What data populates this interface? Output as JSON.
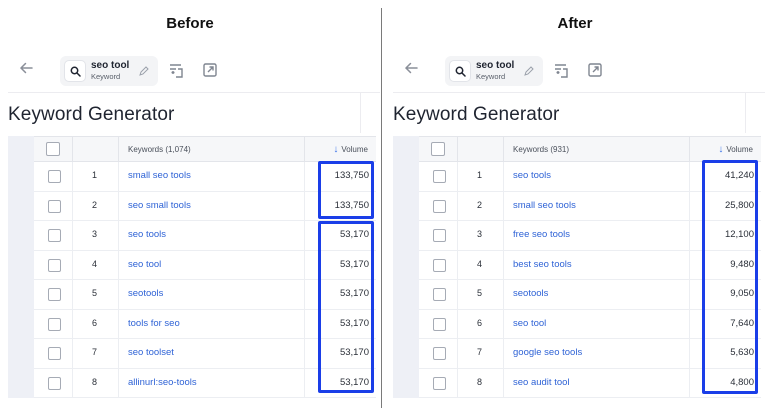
{
  "headings": {
    "before": "Before",
    "after": "After"
  },
  "panels": {
    "before": {
      "chip_title": "seo tool",
      "chip_sub": "Keyword",
      "title": "Keyword Generator",
      "col_keywords": "Keywords (1,074)",
      "col_volume": "Volume",
      "rows": [
        {
          "n": "1",
          "kw": "small seo tools",
          "vol": "133,750"
        },
        {
          "n": "2",
          "kw": "seo small tools",
          "vol": "133,750"
        },
        {
          "n": "3",
          "kw": "seo tools",
          "vol": "53,170"
        },
        {
          "n": "4",
          "kw": "seo tool",
          "vol": "53,170"
        },
        {
          "n": "5",
          "kw": "seotools",
          "vol": "53,170"
        },
        {
          "n": "6",
          "kw": "tools for seo",
          "vol": "53,170"
        },
        {
          "n": "7",
          "kw": "seo toolset",
          "vol": "53,170"
        },
        {
          "n": "8",
          "kw": "allinurl:seo-tools",
          "vol": "53,170"
        }
      ]
    },
    "after": {
      "chip_title": "seo tool",
      "chip_sub": "Keyword",
      "title": "Keyword Generator",
      "col_keywords": "Keywords (931)",
      "col_volume": "Volume",
      "rows": [
        {
          "n": "1",
          "kw": "seo tools",
          "vol": "41,240"
        },
        {
          "n": "2",
          "kw": "small seo tools",
          "vol": "25,800"
        },
        {
          "n": "3",
          "kw": "free seo tools",
          "vol": "12,100"
        },
        {
          "n": "4",
          "kw": "best seo tools",
          "vol": "9,480"
        },
        {
          "n": "5",
          "kw": "seotools",
          "vol": "9,050"
        },
        {
          "n": "6",
          "kw": "seo tool",
          "vol": "7,640"
        },
        {
          "n": "7",
          "kw": "google seo tools",
          "vol": "5,630"
        },
        {
          "n": "8",
          "kw": "seo audit tool",
          "vol": "4,800"
        }
      ]
    }
  },
  "colors": {
    "link": "#2f63d6",
    "highlight": "#1a3ee8",
    "sort_arrow": "#3a72e8"
  }
}
